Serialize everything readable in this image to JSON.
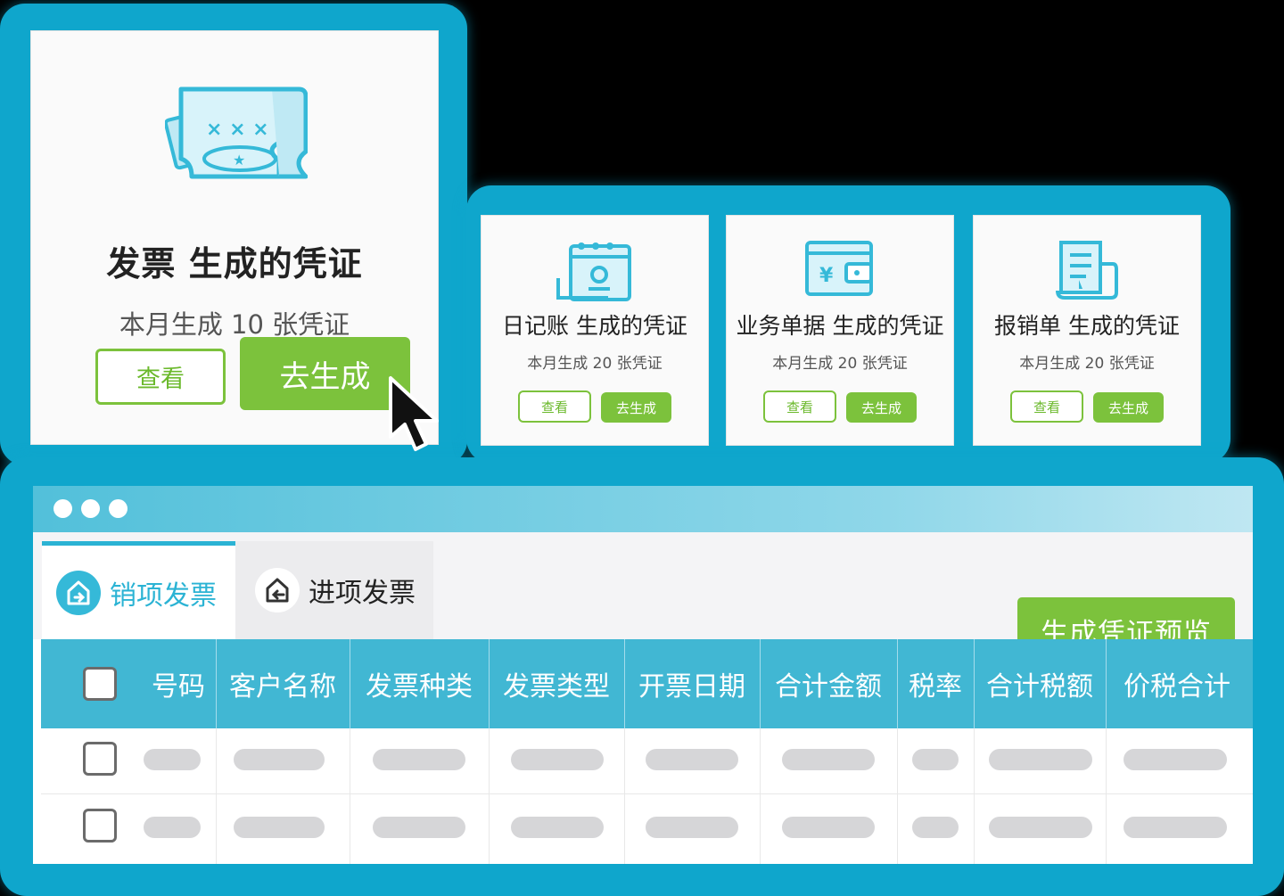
{
  "big_card": {
    "title": "发票 生成的凭证",
    "subtitle": "本月生成 10 张凭证",
    "view_label": "查看",
    "generate_label": "去生成"
  },
  "small_cards": [
    {
      "title": "日记账 生成的凭证",
      "subtitle": "本月生成 20 张凭证",
      "view_label": "查看",
      "generate_label": "去生成",
      "icon": "calendar-icon"
    },
    {
      "title": "业务单据 生成的凭证",
      "subtitle": "本月生成 20 张凭证",
      "view_label": "查看",
      "generate_label": "去生成",
      "icon": "wallet-icon"
    },
    {
      "title": "报销单 生成的凭证",
      "subtitle": "本月生成 20 张凭证",
      "view_label": "查看",
      "generate_label": "去生成",
      "icon": "receipt-icon"
    }
  ],
  "tabs": [
    {
      "label": "销项发票",
      "active": true,
      "icon": "outgoing-invoice-icon"
    },
    {
      "label": "进项发票",
      "active": false,
      "icon": "incoming-invoice-icon"
    }
  ],
  "generate_preview_label": "生成凭证预览",
  "table": {
    "columns": [
      "号码",
      "客户名称",
      "发票种类",
      "发票类型",
      "开票日期",
      "合计金额",
      "税率",
      "合计税额",
      "价税合计"
    ],
    "row_count": 2
  },
  "colors": {
    "frame": "#0fa6cc",
    "accent_green": "#7cc23c",
    "header_blue": "#41b7d3",
    "icon_blue": "#35b9d8"
  }
}
